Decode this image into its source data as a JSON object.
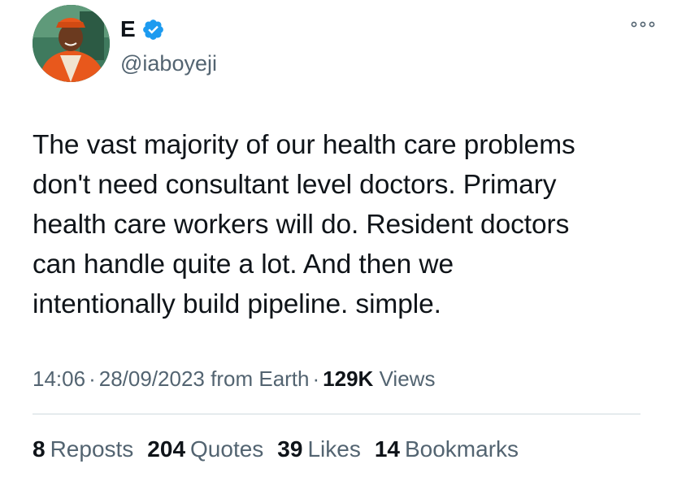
{
  "author": {
    "display_name": "E",
    "handle": "@iaboyeji",
    "verified_icon": "verified-badge-icon",
    "avatar_icon": "profile-photo"
  },
  "tweet": {
    "text": "The vast majority of our health care problems\ndon't need consultant level doctors. Primary\nhealth care workers will do. Resident doctors\ncan handle quite a lot. And then we\nintentionally build pipeline. simple."
  },
  "meta": {
    "time": "14:06",
    "separator": "·",
    "date": "28/09/2023",
    "source": "from Earth",
    "views_count": "129K",
    "views_label": "Views"
  },
  "stats": {
    "reposts": {
      "count": "8",
      "label": "Reposts"
    },
    "quotes": {
      "count": "204",
      "label": "Quotes"
    },
    "likes": {
      "count": "39",
      "label": "Likes"
    },
    "bookmarks": {
      "count": "14",
      "label": "Bookmarks"
    }
  },
  "colors": {
    "primary_text": "#0f1419",
    "secondary_text": "#536471",
    "verified_blue": "#1d9bf0",
    "divider": "#cfd9de"
  }
}
